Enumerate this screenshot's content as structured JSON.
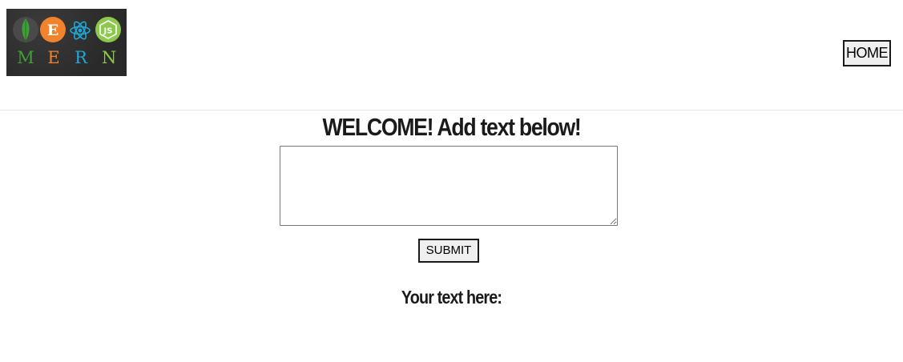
{
  "header": {
    "logo": {
      "letters": [
        "M",
        "E",
        "R",
        "N"
      ],
      "badge_e": "E",
      "badge_js": "JS",
      "icons": [
        "mongodb-leaf-icon",
        "express-e-icon",
        "react-atom-icon",
        "nodejs-js-icon"
      ],
      "colors": {
        "mongo": "#3fa037",
        "express": "#f0832b",
        "react": "#1fa7d8",
        "node": "#8cc84b",
        "background": "#2f2f2f"
      }
    },
    "home_label": "HOME"
  },
  "main": {
    "title": "WELCOME! Add text below!",
    "textarea_value": "",
    "submit_label": "SUBMIT",
    "output_label": "Your text here:"
  }
}
